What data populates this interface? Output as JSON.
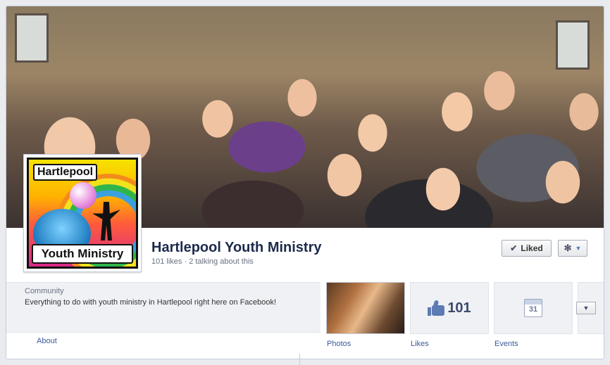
{
  "cover": {
    "alt": "Group photo of youth ministry members"
  },
  "profile": {
    "title_top": "Hartlepool",
    "title_bottom": "Youth Ministry"
  },
  "page": {
    "name": "Hartlepool Youth Ministry",
    "stats": "101 likes · 2 talking about this"
  },
  "actions": {
    "liked_label": "Liked"
  },
  "info": {
    "category": "Community",
    "description": "Everything to do with youth ministry in Hartlepool right here on Facebook!",
    "about_label": "About"
  },
  "tiles": {
    "photos_label": "Photos",
    "likes_count": "101",
    "likes_label": "Likes",
    "events_day": "31",
    "events_label": "Events"
  },
  "icons": [
    "check-icon",
    "gear-icon",
    "chevron-down-icon",
    "thumbs-up-icon",
    "calendar-icon"
  ],
  "colors": {
    "link": "#3b5998",
    "title": "#1c2b4c",
    "muted": "#6a7180"
  }
}
